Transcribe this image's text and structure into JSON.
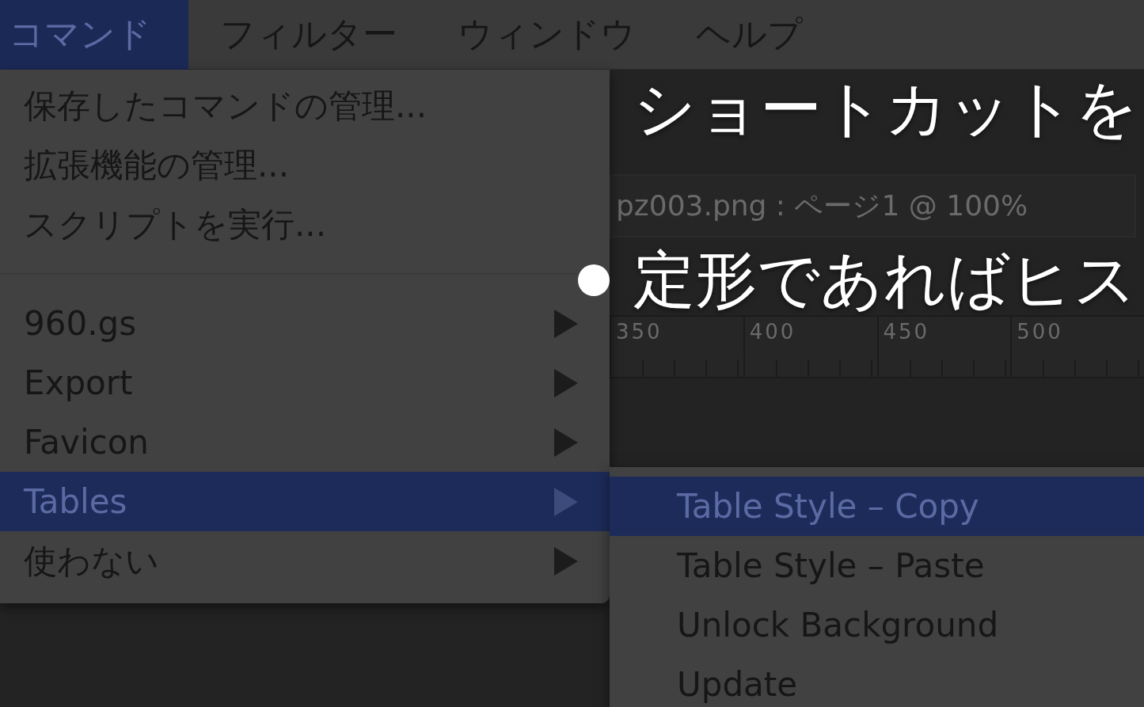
{
  "menubar": [
    {
      "label": "コマンド",
      "selected": true
    },
    {
      "label": "フィルター",
      "selected": false
    },
    {
      "label": "ウィンドウ",
      "selected": false
    },
    {
      "label": "ヘルプ",
      "selected": false
    }
  ],
  "document": {
    "title": "pz003.png : ページ1 @ 100%",
    "ruler": [
      "350",
      "400",
      "450",
      "500"
    ]
  },
  "menu": {
    "items": [
      {
        "kind": "item",
        "label": "保存したコマンドの管理...",
        "selected": false
      },
      {
        "kind": "item",
        "label": "拡張機能の管理...",
        "selected": false
      },
      {
        "kind": "item",
        "label": "スクリプトを実行...",
        "selected": false
      },
      {
        "kind": "separator"
      },
      {
        "kind": "submenu",
        "label": "960.gs",
        "selected": false
      },
      {
        "kind": "submenu",
        "label": "Export",
        "selected": false
      },
      {
        "kind": "submenu",
        "label": "Favicon",
        "selected": false
      },
      {
        "kind": "submenu",
        "label": "Tables",
        "selected": true
      },
      {
        "kind": "submenu",
        "label": "使わない",
        "selected": false
      }
    ]
  },
  "submenu": {
    "items": [
      {
        "label": "Table Style – Copy",
        "selected": true
      },
      {
        "label": "Table Style – Paste",
        "selected": false
      },
      {
        "label": "Unlock Background",
        "selected": false
      },
      {
        "label": "Update",
        "selected": false
      }
    ]
  },
  "slide": {
    "lines": [
      {
        "text": "ショートカットを",
        "bullet": false
      },
      {
        "text": "定形であればヒス",
        "bullet": true
      }
    ]
  }
}
